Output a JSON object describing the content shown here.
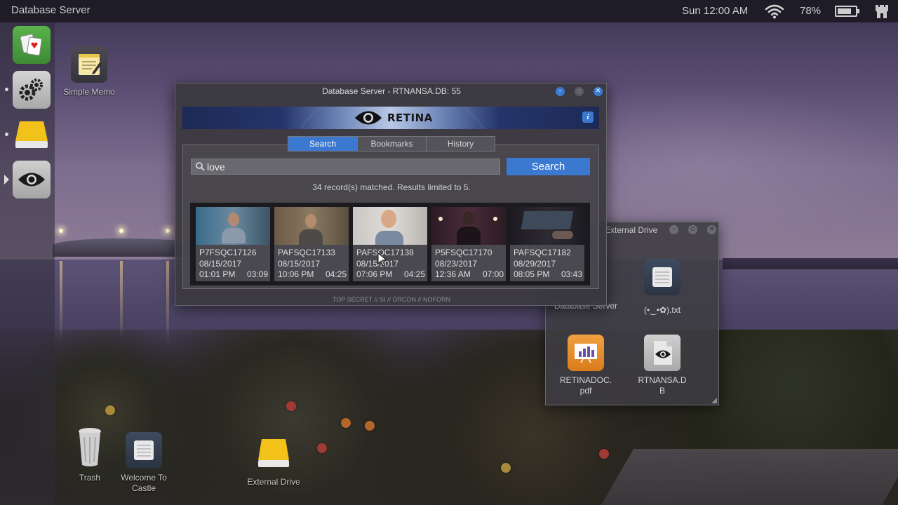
{
  "topbar": {
    "app_title": "Database Server",
    "clock": "Sun 12:00 AM",
    "battery": "78%",
    "battery_level": 0.78
  },
  "dock": {
    "items": [
      {
        "name": "solitaire",
        "icon": "playing-cards-icon"
      },
      {
        "name": "settings",
        "icon": "gears-icon"
      },
      {
        "name": "external-drive",
        "icon": "drive-icon"
      },
      {
        "name": "retina",
        "icon": "eye-icon",
        "active": true
      }
    ]
  },
  "desktop": {
    "simple_memo": "Simple Memo",
    "trash": "Trash",
    "welcome": "Welcome To Castle",
    "external_drive": "External Drive"
  },
  "main_window": {
    "title": "Database Server - RTNANSA.DB: 55",
    "banner_text": "RETINA",
    "tabs": [
      "Search",
      "Bookmarks",
      "History"
    ],
    "active_tab": "Search",
    "search": {
      "value": "love",
      "button": "Search"
    },
    "result_summary": "34 record(s) matched. Results limited to 5.",
    "results": [
      {
        "id": "P7FSQC17126",
        "date": "08/15/2017",
        "time": "01:01 PM",
        "duration": "03:09"
      },
      {
        "id": "PAFSQC17133",
        "date": "08/15/2017",
        "time": "10:06 PM",
        "duration": "04:25"
      },
      {
        "id": "PAFSQC17138",
        "date": "08/15/2017",
        "time": "07:06 PM",
        "duration": "04:25"
      },
      {
        "id": "P5FSQC17170",
        "date": "08/23/2017",
        "time": "12:36 AM",
        "duration": "07:00"
      },
      {
        "id": "PAFSQC17182",
        "date": "08/29/2017",
        "time": "08:05 PM",
        "duration": "03:43"
      }
    ],
    "classification": "TOP SECRET // SI // ORCON // NOFORN"
  },
  "drive_window": {
    "title": "External Drive",
    "items": [
      {
        "label": "Database Server"
      },
      {
        "label": "(•‿•✿).txt"
      },
      {
        "label": "RETINADOC.pdf"
      },
      {
        "label": "RTNANSA.DB"
      }
    ]
  },
  "colors": {
    "accent": "#3b78d0",
    "window_bg": "#3a383e",
    "topbar_bg": "#19181e"
  }
}
